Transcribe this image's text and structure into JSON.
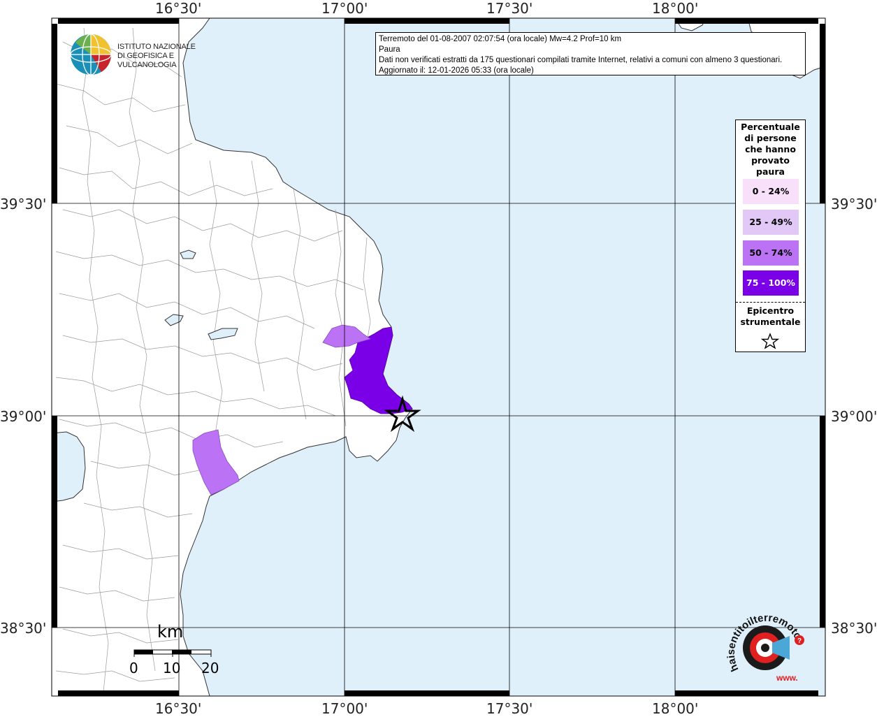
{
  "map": {
    "title": "Terremoto del 01-08-2007 02:07:54 (ora locale) Mw=4.2 Prof=10 km",
    "subtitle": "Paura",
    "note": "Dati non verificati estratti da 175 questionari compilati tramite Internet, relativi a comuni con almeno 3 questionari.",
    "updated": "Aggiornato il: 12-01-2026 05:33 (ora locale)",
    "lon_ticks": [
      "16°30'",
      "17°00'",
      "17°30'",
      "18°00'"
    ],
    "lat_ticks": [
      "39°30'",
      "39°00'",
      "38°30'"
    ],
    "colors": {
      "sea": "#dff0fb",
      "land": "#ffffff",
      "class_0_24": "#f8e0fa",
      "class_25_49": "#e2c8f6",
      "class_50_74": "#bb72f5",
      "class_75_100": "#7a00e8"
    }
  },
  "legend": {
    "title": "Percentuale di persone che hanno provato paura",
    "items": [
      "0 - 24%",
      "25 - 49%",
      "50 - 74%",
      "75 - 100%"
    ],
    "epicenter_label": "Epicentro strumentale",
    "epicenter_icon": "star-icon"
  },
  "scale_bar": {
    "unit": "km",
    "labels": [
      "0",
      "10",
      "20"
    ]
  },
  "logos": {
    "ingv_line1": "ISTITUTO NAZIONALE",
    "ingv_line2": "DI GEOFISICA E VULCANOLOGIA",
    "hst_text": "haisentitoilterremoto.it",
    "hst_url": "www."
  }
}
